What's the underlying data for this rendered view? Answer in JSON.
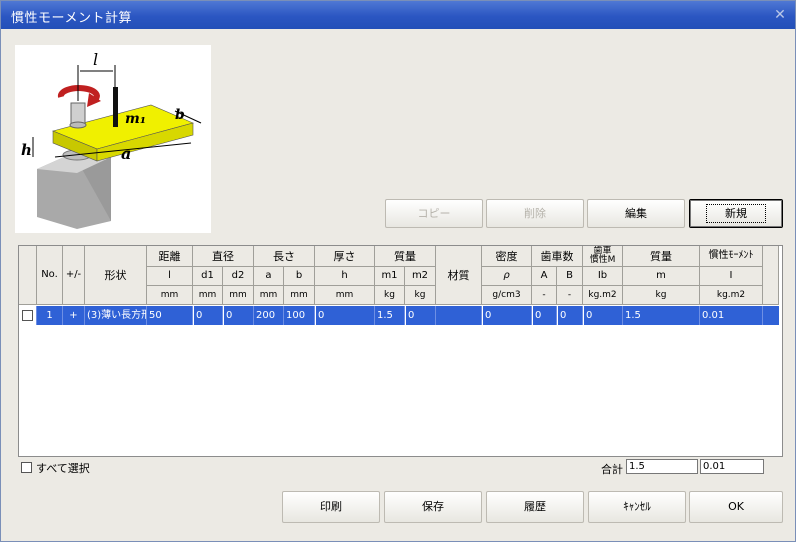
{
  "window": {
    "title": "慣性モーメント計算",
    "close_icon": "close-icon"
  },
  "buttons": {
    "copy": "コピー",
    "delete": "削除",
    "edit": "編集",
    "new": "新規",
    "print": "印刷",
    "save": "保存",
    "history": "履歴",
    "cancel": "ｷｬﾝｾﾙ",
    "ok": "OK"
  },
  "diagram": {
    "l": "l",
    "m1": "m₁",
    "b": "b",
    "h": "h",
    "a": "a"
  },
  "table": {
    "headers": {
      "no": "No.",
      "plusminus": "+/-",
      "shape": "形状",
      "distance": "距離",
      "diameter": "直径",
      "length": "長さ",
      "thickness": "厚さ",
      "mass": "質量",
      "material": "材質",
      "density": "密度",
      "teeth": "歯車数",
      "gear_inertia": "歯車\n慣性M",
      "mass2": "質量",
      "inertia": "慣性ﾓｰﾒﾝﾄ"
    },
    "subheaders": [
      "l",
      "d1",
      "d2",
      "a",
      "b",
      "h",
      "m1",
      "m2",
      "ρ",
      "A",
      "B",
      "Ib",
      "m",
      "I"
    ],
    "units": [
      "mm",
      "mm",
      "mm",
      "mm",
      "mm",
      "mm",
      "kg",
      "kg",
      "g/cm3",
      "-",
      "-",
      "kg.m2",
      "kg",
      "kg.m2"
    ],
    "rows": [
      {
        "no": "1",
        "plusminus": "+",
        "shape": "(3)薄い長方形",
        "l": "50",
        "d1": "0",
        "d2": "0",
        "a": "200",
        "b": "100",
        "h": "0",
        "m1": "1.5",
        "m2": "0",
        "material": "",
        "rho": "0",
        "A": "0",
        "B": "0",
        "Ib": "0",
        "m": "1.5",
        "I": "0.01"
      }
    ]
  },
  "select_all_label": "すべて選択",
  "total": {
    "label": "合計",
    "mass": "1.5",
    "inertia": "0.01"
  }
}
